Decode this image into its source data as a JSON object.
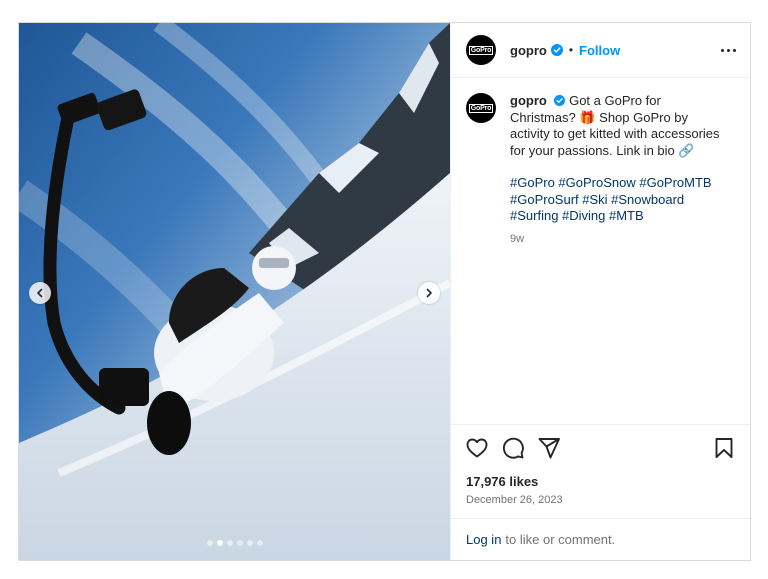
{
  "post": {
    "username": "gopro",
    "avatar_logo": "GoPro",
    "follow_label": "Follow",
    "separator": "•",
    "caption_text": "Got a GoPro for Christmas? 🎁 Shop GoPro by activity to get kitted with accessories for your passions. Link in bio 🔗",
    "hashtags": "#GoPro #GoProSnow #GoProMTB #GoProSurf #Ski #Snowboard #Surfing #Diving #MTB",
    "time_ago": "9w",
    "likes": "17,976 likes",
    "date": "December 26, 2023",
    "login_link": "Log in",
    "login_rest": "to like or comment."
  },
  "carousel": {
    "slide_count": 6,
    "active_index": 1
  },
  "icons": {
    "verified": "verified-badge-icon",
    "more": "more-options-icon",
    "like": "heart-icon",
    "comment": "comment-icon",
    "share": "share-icon",
    "save": "bookmark-icon",
    "prev": "chevron-left-icon",
    "next": "chevron-right-icon"
  },
  "colors": {
    "accent": "#0095f6",
    "link": "#00376b",
    "muted": "#737373",
    "verified": "#0095f6"
  }
}
